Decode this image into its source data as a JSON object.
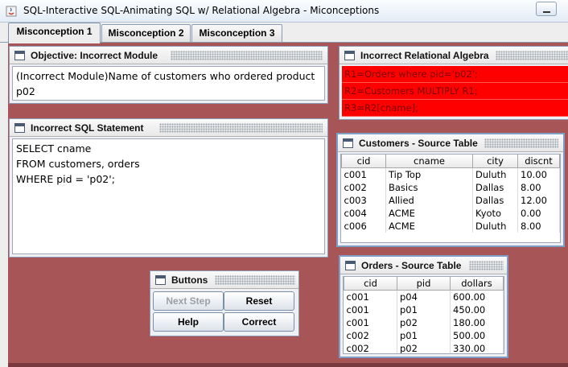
{
  "window": {
    "title": "SQL-Interactive SQL-Animating SQL w/ Relational Algebra - Miconceptions"
  },
  "tabs": [
    {
      "label": "Misconception 1",
      "active": true
    },
    {
      "label": "Misconception 2",
      "active": false
    },
    {
      "label": "Misconception 3",
      "active": false
    }
  ],
  "objective": {
    "title": "Objective: Incorrect Module",
    "text": "(Incorrect Module)Name of customers who ordered product p02"
  },
  "sql": {
    "title": "Incorrect SQL Statement",
    "text": "SELECT cname\nFROM customers, orders\nWHERE pid = 'p02';"
  },
  "relational_algebra": {
    "title": "Incorrect Relational Algebra",
    "lines": [
      "R1=Orders where pid='p02';",
      "R2=Customers MULTIPLY R1;",
      "R3=R2[cname];"
    ],
    "highlight_color": "#ff0000"
  },
  "customers": {
    "title": "Customers - Source Table",
    "columns": [
      "cid",
      "cname",
      "city",
      "discnt"
    ],
    "rows": [
      [
        "c001",
        "Tip Top",
        "Duluth",
        "10.00"
      ],
      [
        "c002",
        "Basics",
        "Dallas",
        "8.00"
      ],
      [
        "c003",
        "Allied",
        "Dallas",
        "12.00"
      ],
      [
        "c004",
        "ACME",
        "Kyoto",
        "0.00"
      ],
      [
        "c006",
        "ACME",
        "Duluth",
        "8.00"
      ]
    ]
  },
  "orders": {
    "title": "Orders - Source Table",
    "columns": [
      "cid",
      "pid",
      "dollars"
    ],
    "rows": [
      [
        "c001",
        "p04",
        "600.00"
      ],
      [
        "c001",
        "p01",
        "450.00"
      ],
      [
        "c001",
        "p02",
        "180.00"
      ],
      [
        "c002",
        "p01",
        "500.00"
      ],
      [
        "c002",
        "p02",
        "330.00"
      ]
    ]
  },
  "buttons": {
    "title": "Buttons",
    "next_step": "Next Step",
    "reset": "Reset",
    "help": "Help",
    "correct": "Correct"
  },
  "colors": {
    "desktop": "#a85558",
    "ra_background": "#ff0000"
  }
}
